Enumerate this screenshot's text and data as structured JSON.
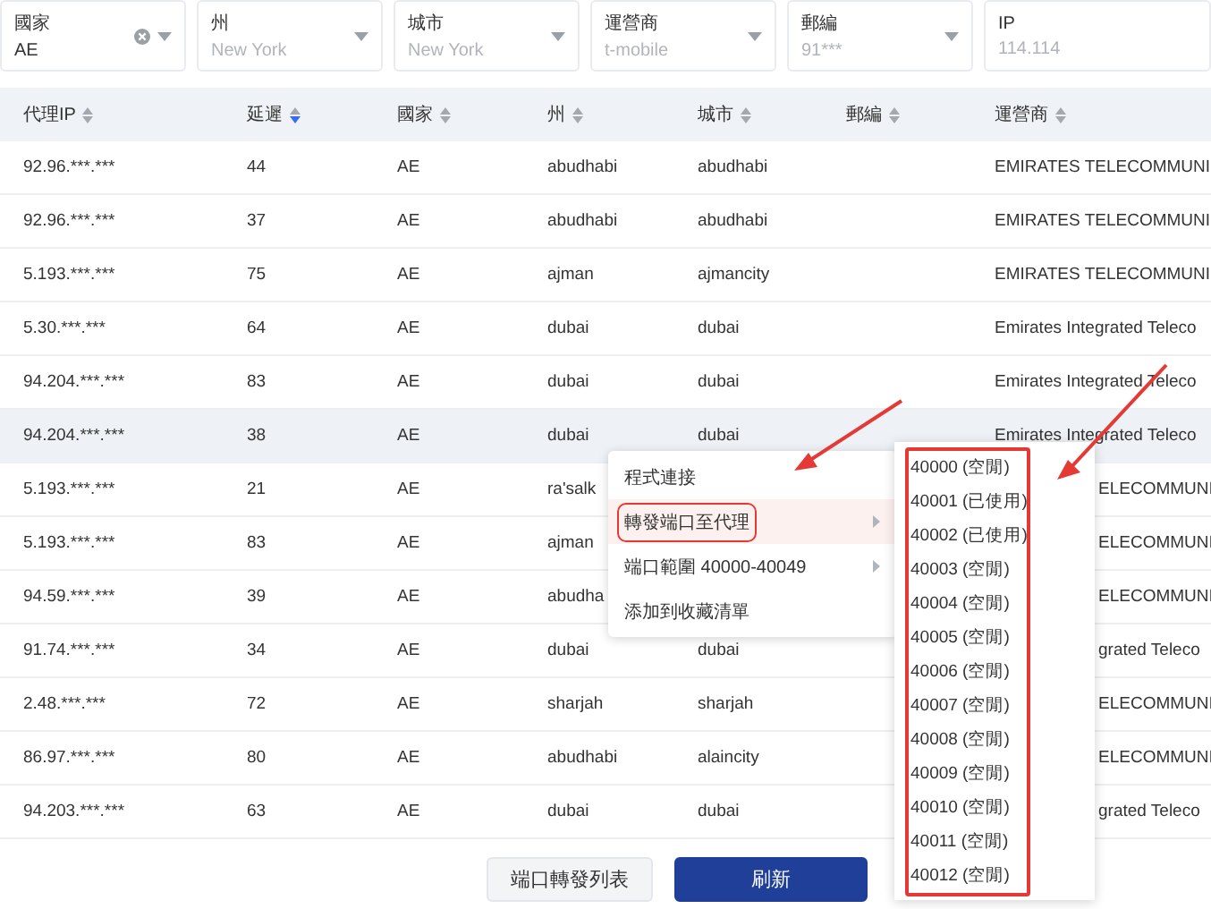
{
  "filters": [
    {
      "label": "國家",
      "value": "AE",
      "clearable": true,
      "dropdown": true
    },
    {
      "label": "州",
      "placeholder": "New York",
      "dropdown": true
    },
    {
      "label": "城市",
      "placeholder": "New York",
      "dropdown": true
    },
    {
      "label": "運營商",
      "placeholder": "t-mobile",
      "dropdown": true
    },
    {
      "label": "郵編",
      "placeholder": "91***",
      "dropdown": true
    },
    {
      "label": "IP",
      "placeholder": "114.114",
      "dropdown": false
    }
  ],
  "table": {
    "columns": [
      {
        "label": "代理IP",
        "sorted": false
      },
      {
        "label": "延遲",
        "sorted": true
      },
      {
        "label": "國家",
        "sorted": false
      },
      {
        "label": "州",
        "sorted": false
      },
      {
        "label": "城市",
        "sorted": false
      },
      {
        "label": "郵編",
        "sorted": false
      },
      {
        "label": "運營商",
        "sorted": false
      }
    ],
    "rows": [
      {
        "ip": "92.96.***.***",
        "latency": "44",
        "country": "AE",
        "state": "abudhabi",
        "city": "abudhabi",
        "carrier": "EMIRATES TELECOMMUNI",
        "hovered": false
      },
      {
        "ip": "92.96.***.***",
        "latency": "37",
        "country": "AE",
        "state": "abudhabi",
        "city": "abudhabi",
        "carrier": "EMIRATES TELECOMMUNI",
        "hovered": false
      },
      {
        "ip": "5.193.***.***",
        "latency": "75",
        "country": "AE",
        "state": "ajman",
        "city": "ajmancity",
        "carrier": "EMIRATES TELECOMMUNI",
        "hovered": false
      },
      {
        "ip": "5.30.***.***",
        "latency": "64",
        "country": "AE",
        "state": "dubai",
        "city": "dubai",
        "carrier": "Emirates Integrated Teleco",
        "hovered": false
      },
      {
        "ip": "94.204.***.***",
        "latency": "83",
        "country": "AE",
        "state": "dubai",
        "city": "dubai",
        "carrier": "Emirates Integrated Teleco",
        "hovered": false
      },
      {
        "ip": "94.204.***.***",
        "latency": "38",
        "country": "AE",
        "state": "dubai",
        "city": "dubai",
        "carrier": "Emirates Integrated Teleco",
        "hovered": true
      },
      {
        "ip": "5.193.***.***",
        "latency": "21",
        "country": "AE",
        "state": "ra'salk",
        "carrier": "ELECOMMUNI",
        "hovered": false
      },
      {
        "ip": "5.193.***.***",
        "latency": "83",
        "country": "AE",
        "state": "ajman",
        "carrier": "ELECOMMUNI",
        "hovered": false
      },
      {
        "ip": "94.59.***.***",
        "latency": "39",
        "country": "AE",
        "state": "abudha",
        "carrier": "ELECOMMUNI",
        "hovered": false
      },
      {
        "ip": "91.74.***.***",
        "latency": "34",
        "country": "AE",
        "state": "dubai",
        "city": "dubai",
        "carrier": "grated Teleco",
        "hovered": false
      },
      {
        "ip": "2.48.***.***",
        "latency": "72",
        "country": "AE",
        "state": "sharjah",
        "city": "sharjah",
        "carrier": "ELECOMMUNI",
        "hovered": false
      },
      {
        "ip": "86.97.***.***",
        "latency": "80",
        "country": "AE",
        "state": "abudhabi",
        "city": "alaincity",
        "carrier": "ELECOMMUNI",
        "hovered": false
      },
      {
        "ip": "94.203.***.***",
        "latency": "63",
        "country": "AE",
        "state": "dubai",
        "city": "dubai",
        "carrier": "grated Teleco",
        "hovered": false
      }
    ]
  },
  "context_menu": {
    "items": [
      {
        "label": "程式連接",
        "submenu": false,
        "selected": false
      },
      {
        "label": "轉發端口至代理",
        "submenu": true,
        "selected": true
      },
      {
        "label": "端口範圍 40000-40049",
        "submenu": true,
        "selected": false
      },
      {
        "label": "添加到收藏清單",
        "submenu": false,
        "selected": false
      }
    ]
  },
  "port_submenu": {
    "items": [
      "40000 (空閒)",
      "40001 (已使用)",
      "40002 (已使用)",
      "40003 (空閒)",
      "40004 (空閒)",
      "40005 (空閒)",
      "40006 (空閒)",
      "40007 (空閒)",
      "40008 (空閒)",
      "40009 (空閒)",
      "40010 (空閒)",
      "40011 (空閒)",
      "40012 (空閒)"
    ]
  },
  "footer": {
    "buttons": [
      {
        "label": "端口轉發列表",
        "primary": false
      },
      {
        "label": "刷新",
        "primary": true
      }
    ]
  }
}
